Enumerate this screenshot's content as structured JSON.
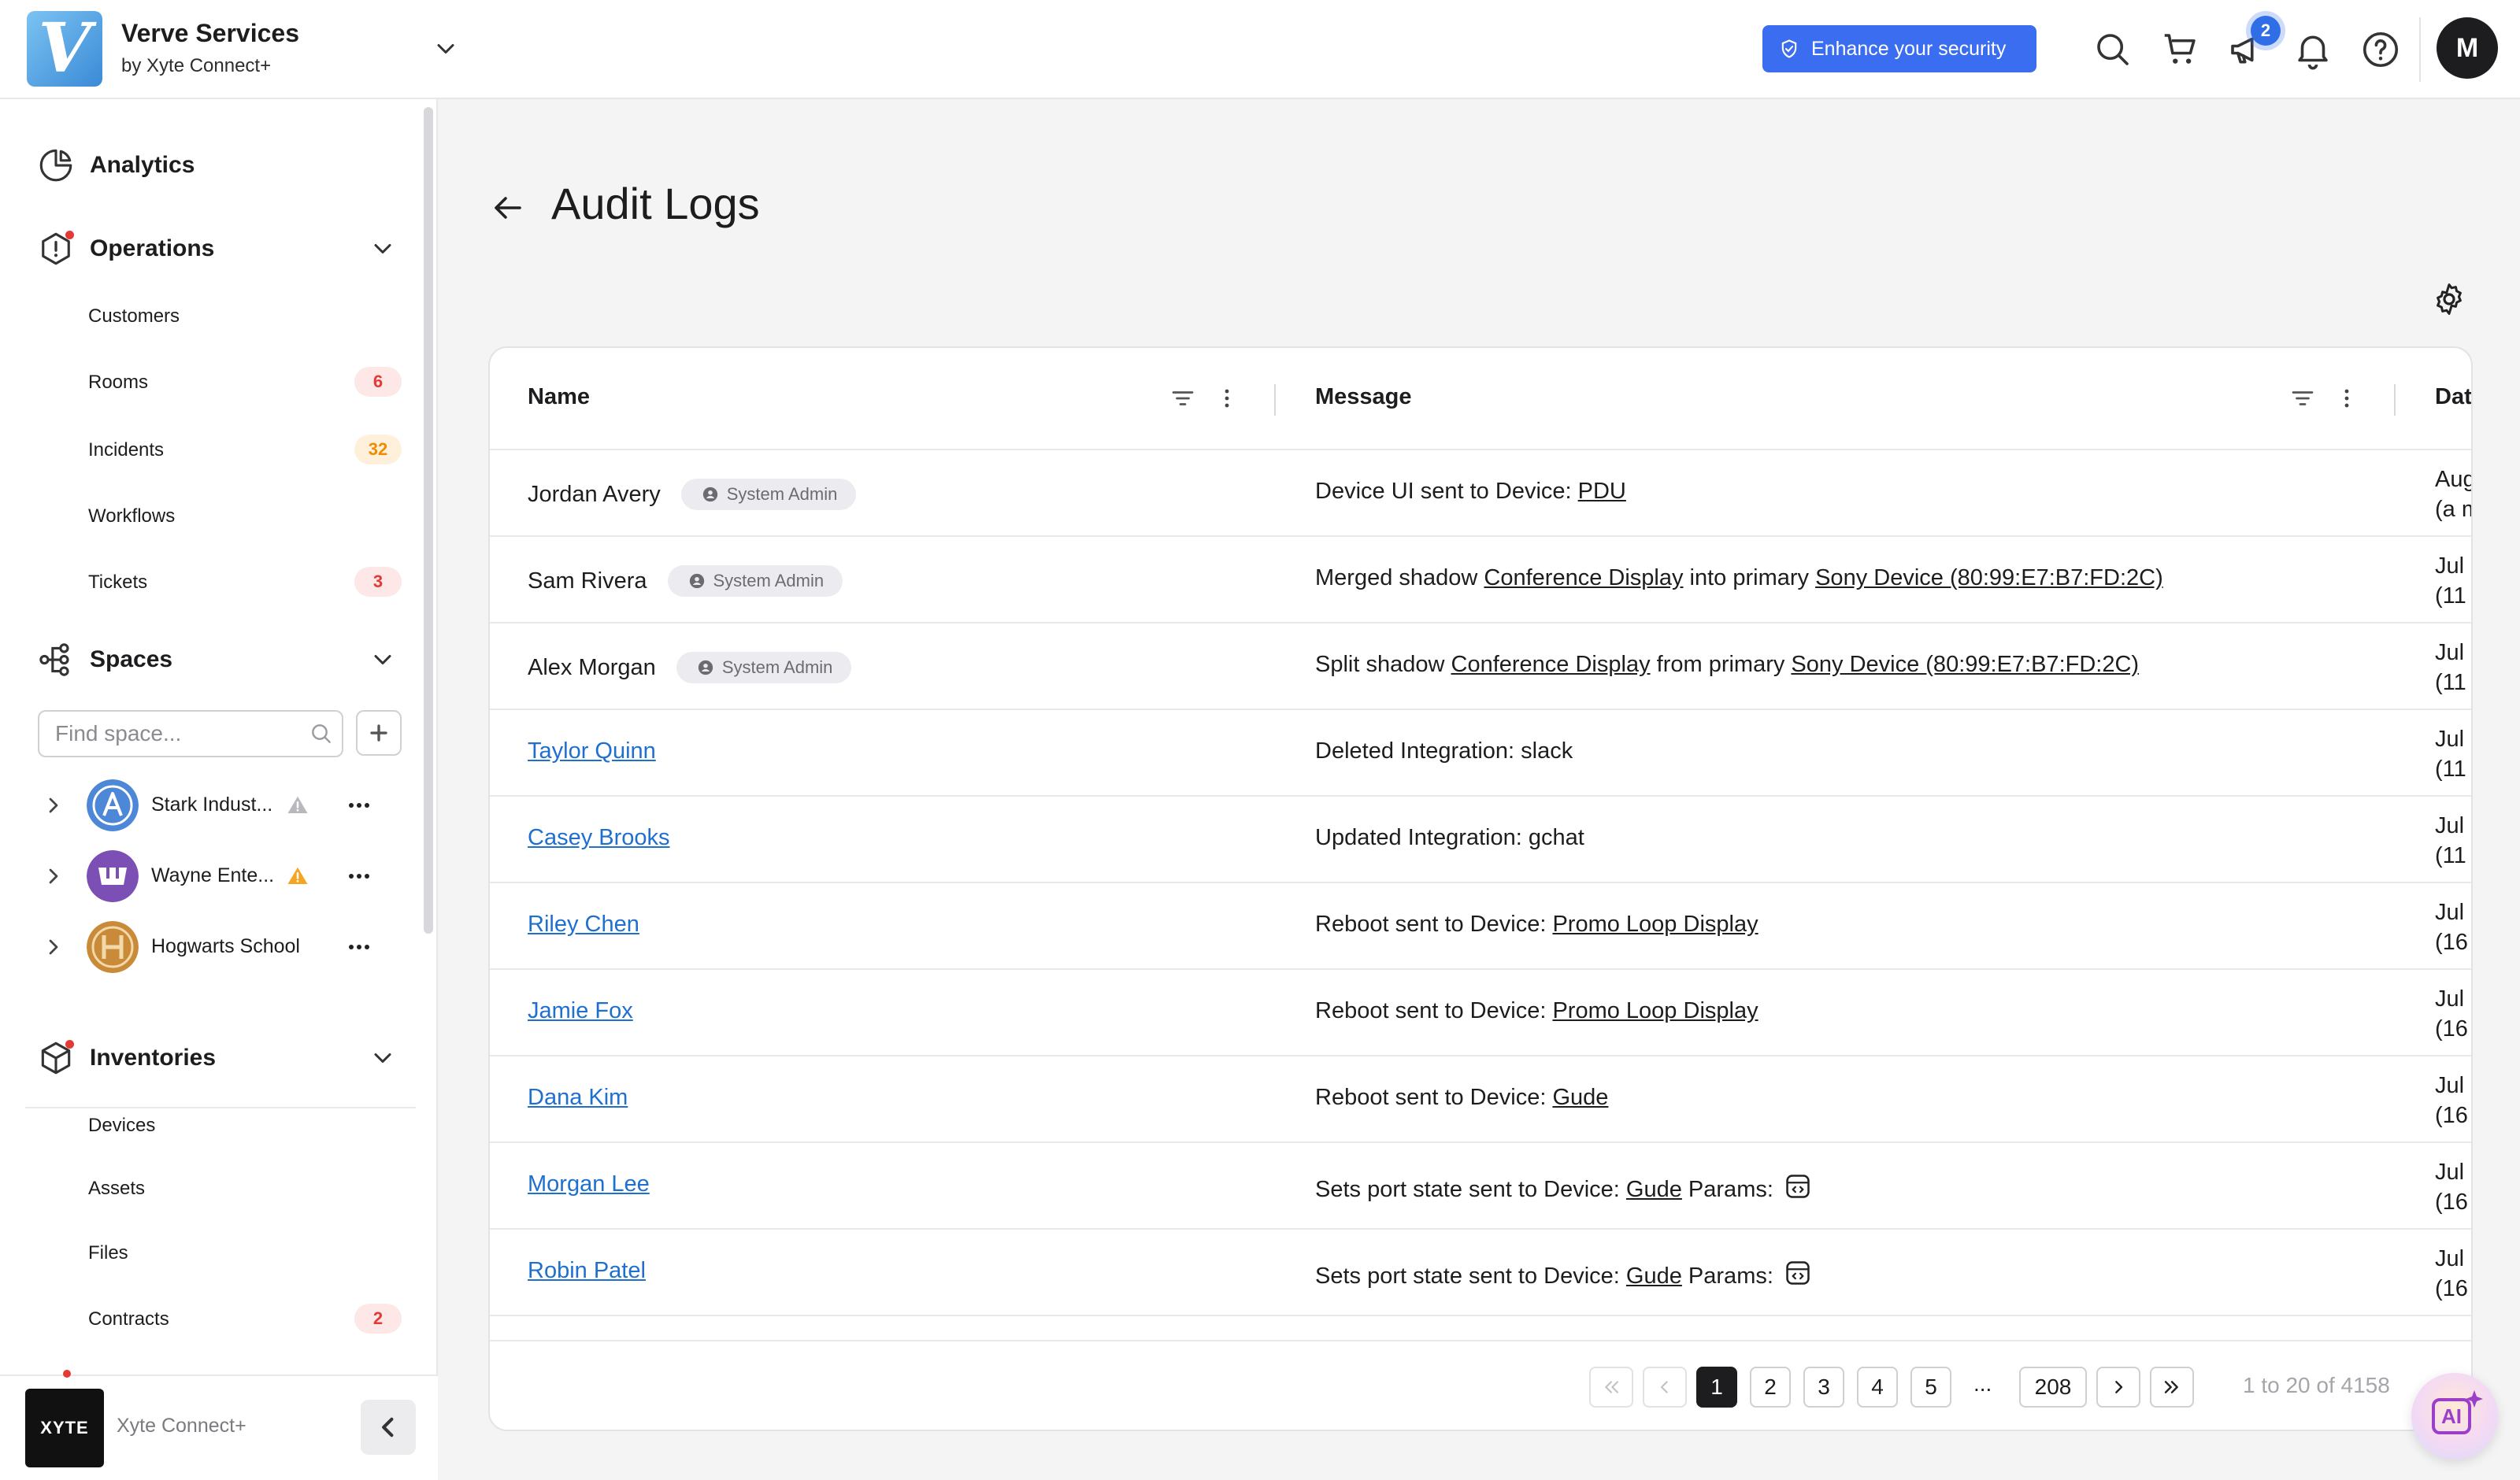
{
  "header": {
    "org_name": "Verve Services",
    "org_sub": "by Xyte Connect+",
    "logo_letter": "V",
    "enhance_label": "Enhance your security",
    "announcements_badge": "2",
    "user_initial": "M",
    "accent_color": "#3a6df0"
  },
  "sidebar": {
    "analytics": "Analytics",
    "operations": {
      "label": "Operations",
      "items": [
        {
          "label": "Customers",
          "count": ""
        },
        {
          "label": "Rooms",
          "count": "6"
        },
        {
          "label": "Incidents",
          "count": "32"
        },
        {
          "label": "Workflows",
          "count": ""
        },
        {
          "label": "Tickets",
          "count": "3"
        }
      ]
    },
    "spaces": {
      "label": "Spaces",
      "search_placeholder": "Find space...",
      "items": [
        {
          "name": "Stark Indust...",
          "warning": "grey"
        },
        {
          "name": "Wayne Ente...",
          "warning": "orange"
        },
        {
          "name": "Hogwarts School",
          "warning": ""
        }
      ]
    },
    "inventories": {
      "label": "Inventories",
      "items": [
        {
          "label": "Devices",
          "count": ""
        },
        {
          "label": "Assets",
          "count": ""
        },
        {
          "label": "Files",
          "count": ""
        },
        {
          "label": "Contracts",
          "count": "2"
        }
      ]
    },
    "footer": {
      "logo_text": "XYTE",
      "name": "Xyte Connect+"
    }
  },
  "page": {
    "title": "Audit Logs"
  },
  "table": {
    "columns": {
      "name": "Name",
      "message": "Message",
      "date": "Dat"
    },
    "rows": [
      {
        "name": "Jordan Avery",
        "role": "System Admin",
        "msg_pre": "Device UI sent to Device: ",
        "link1": "PDU",
        "msg_mid": "",
        "link2": "",
        "params": "",
        "date1": "Aug",
        "date2": "(a m"
      },
      {
        "name": "Sam Rivera",
        "role": "System Admin",
        "msg_pre": "Merged shadow ",
        "link1": "Conference Display",
        "msg_mid": " into primary ",
        "link2": "Sony Device (80:99:E7:B7:FD:2C)",
        "params": "",
        "date1": "Jul",
        "date2": "(11 d"
      },
      {
        "name": "Alex Morgan",
        "role": "System Admin",
        "msg_pre": "Split shadow ",
        "link1": "Conference Display",
        "msg_mid": " from primary ",
        "link2": "Sony Device (80:99:E7:B7:FD:2C)",
        "params": "",
        "date1": "Jul",
        "date2": "(11 d"
      },
      {
        "name": "Taylor Quinn",
        "role": "",
        "msg_pre": "Deleted Integration: slack",
        "link1": "",
        "msg_mid": "",
        "link2": "",
        "params": "",
        "date1": "Jul",
        "date2": "(11 d"
      },
      {
        "name": "Casey Brooks",
        "role": "",
        "msg_pre": "Updated Integration: gchat",
        "link1": "",
        "msg_mid": "",
        "link2": "",
        "params": "",
        "date1": "Jul",
        "date2": "(11 d"
      },
      {
        "name": "Riley Chen",
        "role": "",
        "msg_pre": "Reboot sent to Device: ",
        "link1": "Promo Loop Display",
        "msg_mid": "",
        "link2": "",
        "params": "",
        "date1": "Jul",
        "date2": "(16"
      },
      {
        "name": "Jamie Fox",
        "role": "",
        "msg_pre": "Reboot sent to Device: ",
        "link1": "Promo Loop Display",
        "msg_mid": "",
        "link2": "",
        "params": "",
        "date1": "Jul",
        "date2": "(16"
      },
      {
        "name": "Dana Kim",
        "role": "",
        "msg_pre": "Reboot sent to Device: ",
        "link1": "Gude",
        "msg_mid": "",
        "link2": "",
        "params": "",
        "date1": "Jul",
        "date2": "(16"
      },
      {
        "name": "Morgan Lee",
        "role": "",
        "msg_pre": "Sets port state sent to Device: ",
        "link1": "Gude",
        "msg_mid": " Params:",
        "link2": "",
        "params": "code",
        "date1": "Jul",
        "date2": "(16"
      },
      {
        "name": "Robin Patel",
        "role": "",
        "msg_pre": "Sets port state sent to Device: ",
        "link1": "Gude",
        "msg_mid": " Params:",
        "link2": "",
        "params": "code",
        "date1": "Jul",
        "date2": "(16"
      }
    ]
  },
  "pagination": {
    "pages": [
      "1",
      "2",
      "3",
      "4",
      "5"
    ],
    "ellipsis": "...",
    "last_page": "208",
    "current": "1",
    "summary": "1 to 20 of 4158"
  },
  "ai_button": {
    "label": "AI"
  }
}
